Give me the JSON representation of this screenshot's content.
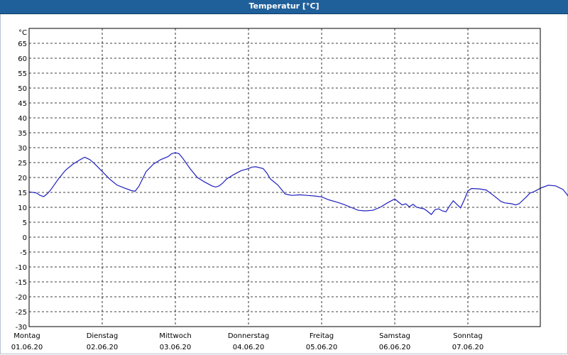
{
  "window": {
    "title": "Temperatur [°C]",
    "title_bar_color": "#1f5f9a"
  },
  "chart_data": {
    "type": "line",
    "title": "Temperatur [°C]",
    "ylabel": "°C",
    "xlabel": "",
    "ylim": [
      -30,
      70
    ],
    "yticks": [
      -30,
      -25,
      -20,
      -15,
      -10,
      -5,
      0,
      5,
      10,
      15,
      20,
      25,
      30,
      35,
      40,
      45,
      50,
      55,
      60,
      65
    ],
    "xlim": [
      0,
      7
    ],
    "grid": true,
    "legend": "none",
    "line_color": "#1f1fbf",
    "days": [
      {
        "day": "Montag",
        "date": "01.06.20"
      },
      {
        "day": "Dienstag",
        "date": "02.06.20"
      },
      {
        "day": "Mittwoch",
        "date": "03.06.20"
      },
      {
        "day": "Donnerstag",
        "date": "04.06.20"
      },
      {
        "day": "Freitag",
        "date": "05.06.20"
      },
      {
        "day": "Samstag",
        "date": "06.06.20"
      },
      {
        "day": "Sonntag",
        "date": "07.06.20"
      }
    ],
    "series": [
      {
        "points": [
          [
            0.0,
            15.2
          ],
          [
            0.1,
            14.8
          ],
          [
            0.15,
            14.0
          ],
          [
            0.2,
            13.6
          ],
          [
            0.25,
            14.6
          ],
          [
            0.3,
            16.0
          ],
          [
            0.4,
            19.5
          ],
          [
            0.5,
            22.5
          ],
          [
            0.6,
            24.5
          ],
          [
            0.7,
            26.0
          ],
          [
            0.76,
            26.8
          ],
          [
            0.83,
            26.0
          ],
          [
            0.9,
            24.5
          ],
          [
            1.0,
            22.0
          ],
          [
            1.1,
            19.5
          ],
          [
            1.2,
            17.5
          ],
          [
            1.3,
            16.5
          ],
          [
            1.4,
            15.6
          ],
          [
            1.45,
            15.4
          ],
          [
            1.5,
            17.0
          ],
          [
            1.55,
            19.5
          ],
          [
            1.6,
            22.0
          ],
          [
            1.7,
            24.5
          ],
          [
            1.8,
            26.0
          ],
          [
            1.9,
            27.0
          ],
          [
            1.95,
            28.0
          ],
          [
            2.0,
            28.3
          ],
          [
            2.05,
            28.0
          ],
          [
            2.1,
            26.5
          ],
          [
            2.2,
            23.0
          ],
          [
            2.3,
            20.0
          ],
          [
            2.4,
            18.5
          ],
          [
            2.5,
            17.2
          ],
          [
            2.55,
            16.8
          ],
          [
            2.6,
            17.2
          ],
          [
            2.65,
            18.2
          ],
          [
            2.7,
            19.5
          ],
          [
            2.8,
            21.0
          ],
          [
            2.9,
            22.3
          ],
          [
            3.0,
            23.0
          ],
          [
            3.05,
            23.5
          ],
          [
            3.1,
            23.6
          ],
          [
            3.2,
            23.0
          ],
          [
            3.25,
            21.5
          ],
          [
            3.3,
            19.5
          ],
          [
            3.4,
            17.5
          ],
          [
            3.45,
            16.0
          ],
          [
            3.5,
            14.5
          ],
          [
            3.55,
            14.2
          ],
          [
            3.6,
            14.0
          ],
          [
            3.7,
            14.2
          ],
          [
            3.8,
            14.0
          ],
          [
            3.9,
            13.8
          ],
          [
            4.0,
            13.5
          ],
          [
            4.1,
            12.5
          ],
          [
            4.2,
            11.8
          ],
          [
            4.3,
            11.0
          ],
          [
            4.4,
            10.0
          ],
          [
            4.5,
            9.0
          ],
          [
            4.6,
            8.8
          ],
          [
            4.7,
            9.0
          ],
          [
            4.8,
            10.0
          ],
          [
            4.9,
            11.5
          ],
          [
            5.0,
            12.8
          ],
          [
            5.05,
            11.8
          ],
          [
            5.1,
            10.8
          ],
          [
            5.15,
            11.2
          ],
          [
            5.2,
            10.2
          ],
          [
            5.25,
            11.0
          ],
          [
            5.3,
            10.0
          ],
          [
            5.4,
            9.5
          ],
          [
            5.45,
            8.6
          ],
          [
            5.5,
            7.6
          ],
          [
            5.55,
            9.2
          ],
          [
            5.6,
            9.5
          ],
          [
            5.65,
            8.8
          ],
          [
            5.7,
            8.5
          ],
          [
            5.75,
            10.5
          ],
          [
            5.8,
            12.2
          ],
          [
            5.85,
            11.0
          ],
          [
            5.9,
            9.8
          ],
          [
            5.95,
            12.5
          ],
          [
            6.0,
            15.5
          ],
          [
            6.05,
            16.3
          ],
          [
            6.15,
            16.2
          ],
          [
            6.25,
            15.8
          ],
          [
            6.35,
            14.0
          ],
          [
            6.45,
            12.0
          ],
          [
            6.5,
            11.5
          ],
          [
            6.6,
            11.2
          ],
          [
            6.65,
            10.8
          ],
          [
            6.7,
            11.2
          ],
          [
            6.8,
            13.5
          ],
          [
            6.85,
            14.8
          ],
          [
            6.9,
            15.2
          ],
          [
            7.0,
            16.5
          ],
          [
            7.1,
            17.4
          ],
          [
            7.2,
            17.2
          ],
          [
            7.3,
            16.0
          ],
          [
            7.35,
            14.5
          ],
          [
            7.4,
            12.8
          ]
        ]
      }
    ]
  }
}
